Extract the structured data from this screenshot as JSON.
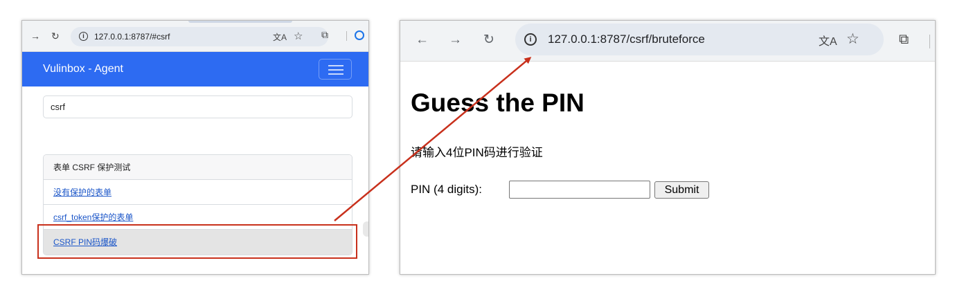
{
  "left_browser": {
    "url": "127.0.0.1:8787/#csrf",
    "brand": "Vulinbox - Agent",
    "search_value": "csrf",
    "list": {
      "header": "表单 CSRF 保护测试",
      "items": [
        {
          "label": "没有保护的表单"
        },
        {
          "label": "csrf_token保护的表单"
        },
        {
          "label": "CSRF PIN码爆破"
        }
      ]
    }
  },
  "right_browser": {
    "url": "127.0.0.1:8787/csrf/bruteforce",
    "page": {
      "title": "Guess the PIN",
      "description": "请输入4位PIN码进行验证",
      "pin_label": "PIN (4 digits):",
      "pin_value": "",
      "submit_label": "Submit"
    }
  },
  "annotation": {
    "highlight_color": "#c8301c",
    "arrow_color": "#c8301c"
  },
  "icons": [
    "back-icon",
    "forward-icon",
    "reload-icon",
    "info-icon",
    "translate-icon",
    "star-icon",
    "extensions-icon",
    "account-icon",
    "menu-icon"
  ]
}
